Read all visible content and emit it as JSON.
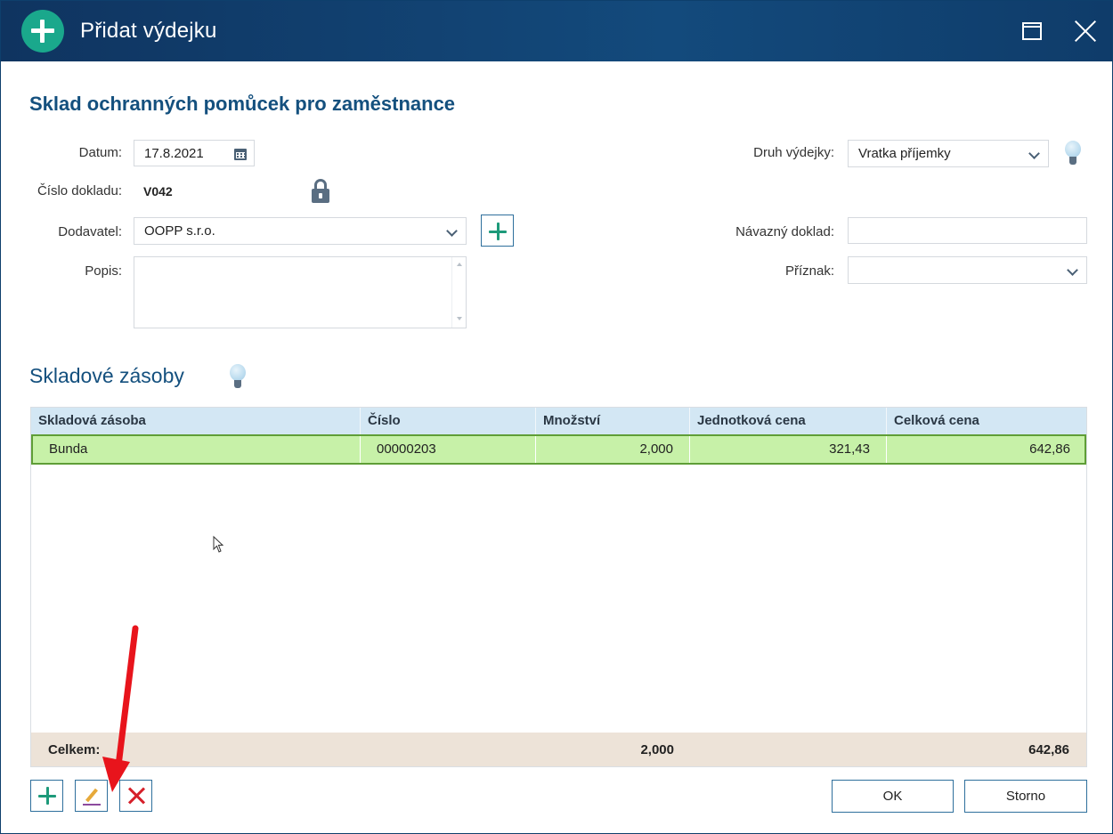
{
  "window": {
    "title": "Přidat výdejku",
    "icons": {
      "title": "plus-circle-icon",
      "maximize": "maximize-icon",
      "close": "close-icon"
    }
  },
  "form": {
    "heading": "Sklad ochranných pomůcek pro zaměstnance",
    "datum_label": "Datum:",
    "datum_value": "17.8.2021",
    "cislo_label": "Číslo dokladu:",
    "cislo_value": "V042",
    "dodavatel_label": "Dodavatel:",
    "dodavatel_value": "OOPP s.r.o.",
    "popis_label": "Popis:",
    "popis_value": "",
    "druh_label": "Druh výdejky:",
    "druh_value": "Vratka příjemky",
    "navazny_label": "Návazný doklad:",
    "navazny_value": "",
    "priznak_label": "Příznak:",
    "priznak_value": ""
  },
  "stock": {
    "title": "Skladové zásoby",
    "columns": [
      "Skladová zásoba",
      "Číslo",
      "Množství",
      "Jednotková cena",
      "Celková cena"
    ],
    "rows": [
      {
        "name": "Bunda",
        "number": "00000203",
        "quantity": "2,000",
        "unit_price": "321,43",
        "total_price": "642,86"
      }
    ],
    "footer": {
      "label": "Celkem:",
      "quantity": "2,000",
      "total_price": "642,86"
    }
  },
  "toolbar": {
    "add": "plus-icon",
    "edit": "pencil-icon",
    "delete": "delete-x-icon"
  },
  "buttons": {
    "ok": "OK",
    "cancel": "Storno"
  },
  "colors": {
    "titlebar": "#134a7c",
    "accent_teal": "#1aa88c",
    "heading_blue": "#14507e",
    "row_selected": "#c7f1a8",
    "row_selected_border": "#5f9e37",
    "footer_bg": "#ede3d8",
    "header_bg": "#d3e7f4",
    "annotation_arrow": "#e8141c"
  }
}
